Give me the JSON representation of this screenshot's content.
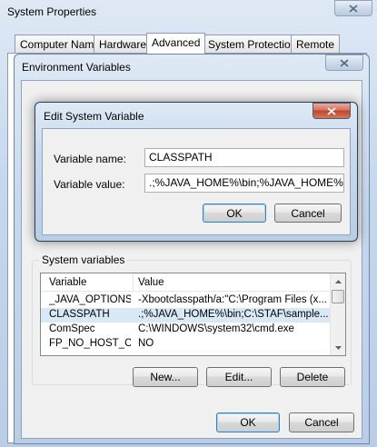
{
  "system_properties": {
    "title": "System Properties",
    "tabs": [
      "Computer Name",
      "Hardware",
      "Advanced",
      "System Protection",
      "Remote"
    ],
    "active_tab": "Advanced"
  },
  "environment_variables": {
    "title": "Environment Variables",
    "system_group_label": "System variables",
    "columns": [
      "Variable",
      "Value"
    ],
    "rows": [
      {
        "variable": "_JAVA_OPTIONS",
        "value": "-Xbootclasspath/a:\"C:\\Program Files (x..."
      },
      {
        "variable": "CLASSPATH",
        "value": ".;%JAVA_HOME%\\bin;C:\\STAF\\sample..."
      },
      {
        "variable": "ComSpec",
        "value": "C:\\WINDOWS\\system32\\cmd.exe"
      },
      {
        "variable": "FP_NO_HOST_C...",
        "value": "NO"
      }
    ],
    "selected_row": 1,
    "buttons": {
      "new": "New...",
      "edit": "Edit...",
      "delete": "Delete"
    },
    "ok": "OK",
    "cancel": "Cancel"
  },
  "edit_dialog": {
    "title": "Edit System Variable",
    "name_label": "Variable name:",
    "name_value": "CLASSPATH",
    "value_label": "Variable value:",
    "value_value": ".;%JAVA_HOME%\\bin;%JAVA_HOME%\\lre",
    "ok": "OK",
    "cancel": "Cancel"
  },
  "icons": {
    "close": "close-icon",
    "scroll_up": "chevron-up-icon",
    "scroll_down": "chevron-down-icon"
  }
}
